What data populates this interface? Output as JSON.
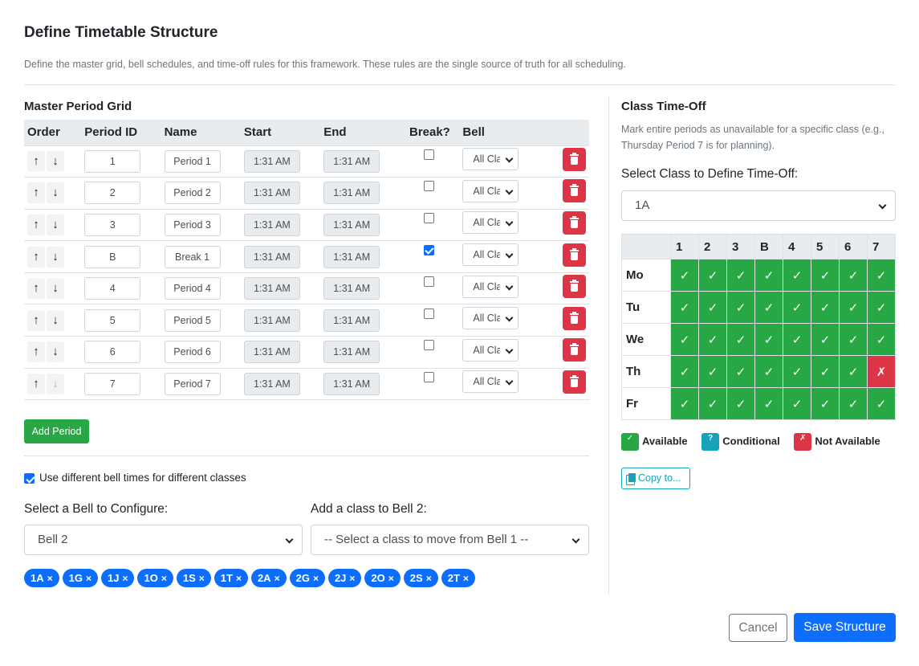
{
  "header": {
    "title": "Define Timetable Structure",
    "description": "Define the master grid, bell schedules, and time-off rules for this framework. These rules are the single source of truth for all scheduling."
  },
  "grid": {
    "title": "Master Period Grid",
    "columns": [
      "Order",
      "Period ID",
      "Name",
      "Start",
      "End",
      "Break?",
      "Bell"
    ],
    "rows": [
      {
        "id": "1",
        "name": "Period 1",
        "start": "1:31 AM",
        "end": "1:31 AM",
        "is_break": false,
        "bell": "All Classes"
      },
      {
        "id": "2",
        "name": "Period 2",
        "start": "1:31 AM",
        "end": "1:31 AM",
        "is_break": false,
        "bell": "All Classes"
      },
      {
        "id": "3",
        "name": "Period 3",
        "start": "1:31 AM",
        "end": "1:31 AM",
        "is_break": false,
        "bell": "All Classes"
      },
      {
        "id": "B",
        "name": "Break 1",
        "start": "1:31 AM",
        "end": "1:31 AM",
        "is_break": true,
        "bell": "All Classes"
      },
      {
        "id": "4",
        "name": "Period 4",
        "start": "1:31 AM",
        "end": "1:31 AM",
        "is_break": false,
        "bell": "All Classes"
      },
      {
        "id": "5",
        "name": "Period 5",
        "start": "1:31 AM",
        "end": "1:31 AM",
        "is_break": false,
        "bell": "All Classes"
      },
      {
        "id": "6",
        "name": "Period 6",
        "start": "1:31 AM",
        "end": "1:31 AM",
        "is_break": false,
        "bell": "All Classes"
      },
      {
        "id": "7",
        "name": "Period 7",
        "start": "1:31 AM",
        "end": "1:31 AM",
        "is_break": false,
        "bell": "All Classes"
      }
    ],
    "add_label": "Add Period"
  },
  "bells": {
    "use_different_label": "Use different bell times for different classes",
    "use_different_checked": true,
    "select_label": "Select a Bell to Configure:",
    "selected_bell": "Bell 2",
    "add_class_label": "Add a class to Bell 2:",
    "add_class_placeholder": "-- Select a class to move from Bell 1 --",
    "classes": [
      "1A",
      "1G",
      "1J",
      "1O",
      "1S",
      "1T",
      "2A",
      "2G",
      "2J",
      "2O",
      "2S",
      "2T"
    ],
    "remove_glyph": "×"
  },
  "timeoff": {
    "title": "Class Time-Off",
    "description": "Mark entire periods as unavailable for a specific class (e.g., Thursday Period 7 is for planning).",
    "select_label": "Select Class to Define Time-Off:",
    "selected_class": "1A",
    "periods": [
      "1",
      "2",
      "3",
      "B",
      "4",
      "5",
      "6",
      "7"
    ],
    "days": [
      "Mo",
      "Tu",
      "We",
      "Th",
      "Fr"
    ],
    "unavailable": [
      {
        "day": "Th",
        "period": "7"
      }
    ],
    "available_glyph": "✓",
    "unavailable_glyph": "✗",
    "legend": {
      "available": "Available",
      "conditional": "Conditional",
      "not_available": "Not Available",
      "available_glyph": "✓",
      "conditional_glyph": "?",
      "not_available_glyph": "✗"
    },
    "copy_label": "Copy to..."
  },
  "footer": {
    "cancel_label": "Cancel",
    "save_label": "Save Structure"
  },
  "colors": {
    "primary": "#0d6efd",
    "success": "#28a745",
    "danger": "#dc3545",
    "info": "#17a2b8"
  }
}
